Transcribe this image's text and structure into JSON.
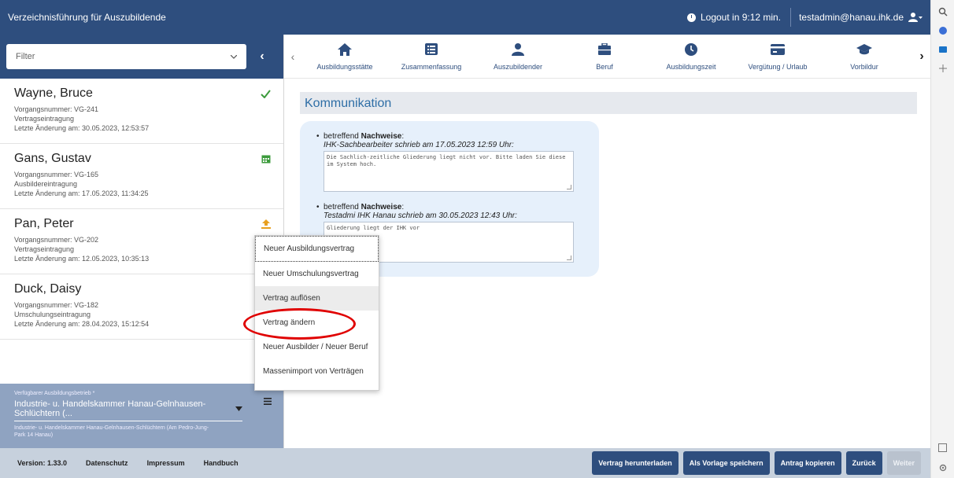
{
  "app": {
    "title": "Verzeichnisführung für Auszubildende",
    "logout_text": "Logout in 9:12 min.",
    "user_email": "testadmin@hanau.ihk.de"
  },
  "filter": {
    "label": "Filter"
  },
  "records": [
    {
      "name": "Wayne, Bruce",
      "number": "Vorgangsnummer: VG-241",
      "type": "Vertragseintragung",
      "changed": "Letzte Änderung am: 30.05.2023, 12:53:57",
      "status_icon": "check-icon",
      "status_color": "#3c9b3c"
    },
    {
      "name": "Gans, Gustav",
      "number": "Vorgangsnummer: VG-165",
      "type": "Ausbildereintragung",
      "changed": "Letzte Änderung am: 17.05.2023, 11:34:25",
      "status_icon": "calendar-icon",
      "status_color": "#3c9b3c"
    },
    {
      "name": "Pan, Peter",
      "number": "Vorgangsnummer: VG-202",
      "type": "Vertragseintragung",
      "changed": "Letzte Änderung am: 12.05.2023, 10:35:13",
      "status_icon": "upload-icon",
      "status_color": "#e8a020"
    },
    {
      "name": "Duck, Daisy",
      "number": "Vorgangsnummer: VG-182",
      "type": "Umschulungseintragung",
      "changed": "Letzte Änderung am: 28.04.2023, 15:12:54",
      "status_icon": "",
      "status_color": ""
    }
  ],
  "company": {
    "label": "Verfügbarer Ausbildungsbetrieb *",
    "selected": "Industrie- u. Handelskammer Hanau-Gelnhausen-Schlüchtern (...",
    "address": "Industrie- u. Handelskammer Hanau-Gelnhausen-Schlüchtern (Am Pedro-Jung-Park 14 Hanau)"
  },
  "tabs": [
    {
      "label": "Ausbildungsstätte",
      "icon": "home-icon"
    },
    {
      "label": "Zusammenfassung",
      "icon": "list-icon"
    },
    {
      "label": "Auszubildender",
      "icon": "person-icon"
    },
    {
      "label": "Beruf",
      "icon": "briefcase-icon"
    },
    {
      "label": "Ausbildungszeit",
      "icon": "clock-icon"
    },
    {
      "label": "Vergütung / Urlaub",
      "icon": "card-icon"
    },
    {
      "label": "Vorbildur",
      "icon": "graduation-icon"
    }
  ],
  "section": {
    "title": "Kommunikation"
  },
  "messages": [
    {
      "about_prefix": "betreffend ",
      "about_bold": "Nachweise",
      "about_suffix": ":",
      "author": "IHK-Sachbearbeiter schrieb am 17.05.2023 12:59 Uhr:",
      "text": "Die Sachlich-zeitliche Gliederung liegt nicht vor. Bitte laden Sie diese im System hoch."
    },
    {
      "about_prefix": "betreffend ",
      "about_bold": "Nachweise",
      "about_suffix": ":",
      "author": "Testadmi IHK Hanau schrieb am 30.05.2023 12:43 Uhr:",
      "text": "Gliederung liegt der IHK vor"
    }
  ],
  "menu": {
    "items": [
      {
        "label": "Neuer Ausbildungsvertrag"
      },
      {
        "label": "Neuer Umschulungsvertrag"
      },
      {
        "label": "Vertrag auflösen"
      },
      {
        "label": "Vertrag ändern"
      },
      {
        "label": "Neuer Ausbilder / Neuer Beruf"
      },
      {
        "label": "Massenimport von Verträgen"
      }
    ]
  },
  "footer": {
    "version": "Version: 1.33.0",
    "privacy": "Datenschutz",
    "imprint": "Impressum",
    "manual": "Handbuch"
  },
  "actions": {
    "download": "Vertrag herunterladen",
    "save_template": "Als Vorlage speichern",
    "copy": "Antrag kopieren",
    "back": "Zurück",
    "next": "Weiter"
  },
  "colors": {
    "primary": "#2e4e7e",
    "highlight": "#e00000",
    "comm_bg": "#e6f0fb"
  }
}
